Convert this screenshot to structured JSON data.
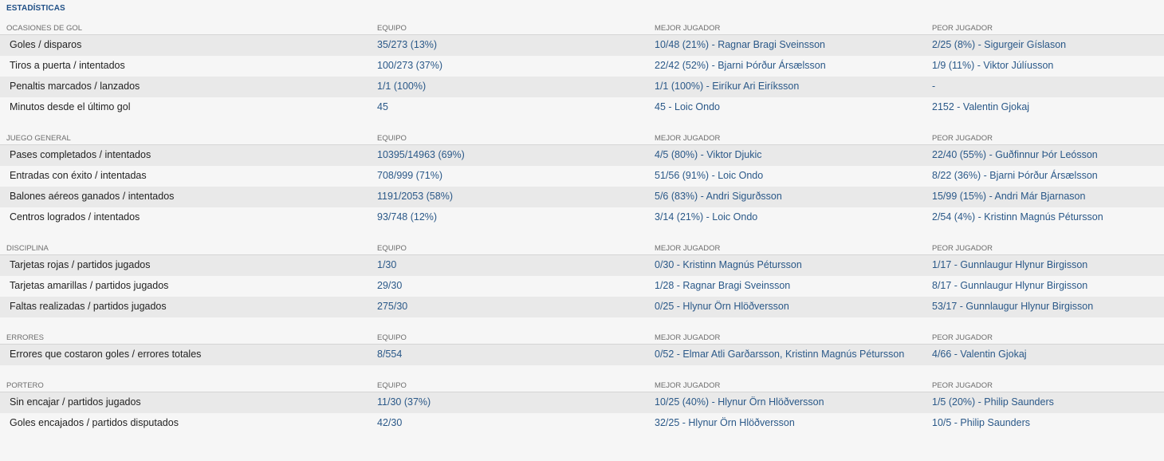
{
  "page_title": "ESTADÍSTICAS",
  "columns": {
    "team": "EQUIPO",
    "best": "MEJOR JUGADOR",
    "worst": "PEOR JUGADOR"
  },
  "sections": [
    {
      "title": "OCASIONES DE GOL",
      "rows": [
        {
          "label": "Goles / disparos",
          "team": "35/273 (13%)",
          "best": "10/48 (21%) - Ragnar Bragi Sveinsson",
          "worst": "2/25 (8%) - Sigurgeir Gíslason"
        },
        {
          "label": "Tiros a puerta / intentados",
          "team": "100/273 (37%)",
          "best": "22/42 (52%) - Bjarni Þórður Ársælsson",
          "worst": "1/9 (11%) - Viktor Júlíusson"
        },
        {
          "label": "Penaltis marcados / lanzados",
          "team": "1/1 (100%)",
          "best": "1/1 (100%) - Eiríkur Ari Eiríksson",
          "worst": "-"
        },
        {
          "label": "Minutos desde el último gol",
          "team": "45",
          "best": "45 - Loic Ondo",
          "worst": "2152 - Valentin Gjokaj"
        }
      ]
    },
    {
      "title": "JUEGO GENERAL",
      "rows": [
        {
          "label": "Pases completados / intentados",
          "team": "10395/14963 (69%)",
          "best": "4/5 (80%) - Viktor Djukic",
          "worst": "22/40 (55%) - Guðfinnur Þór Leósson"
        },
        {
          "label": "Entradas con éxito / intentadas",
          "team": "708/999 (71%)",
          "best": "51/56 (91%) - Loic Ondo",
          "worst": "8/22 (36%) - Bjarni Þórður Ársælsson"
        },
        {
          "label": "Balones aéreos ganados / intentados",
          "team": "1191/2053 (58%)",
          "best": "5/6 (83%) - Andri Sigurðsson",
          "worst": "15/99 (15%) - Andri Már Bjarnason"
        },
        {
          "label": "Centros logrados / intentados",
          "team": "93/748 (12%)",
          "best": "3/14 (21%) - Loic Ondo",
          "worst": "2/54 (4%) - Kristinn Magnús Pétursson"
        }
      ]
    },
    {
      "title": "DISCIPLINA",
      "rows": [
        {
          "label": "Tarjetas rojas / partidos jugados",
          "team": "1/30",
          "best": "0/30 - Kristinn Magnús Pétursson",
          "worst": "1/17 - Gunnlaugur Hlynur Birgisson"
        },
        {
          "label": "Tarjetas amarillas / partidos jugados",
          "team": "29/30",
          "best": "1/28 - Ragnar Bragi Sveinsson",
          "worst": "8/17 - Gunnlaugur Hlynur Birgisson"
        },
        {
          "label": "Faltas realizadas / partidos jugados",
          "team": "275/30",
          "best": "0/25 - Hlynur Örn Hlöðversson",
          "worst": "53/17 - Gunnlaugur Hlynur Birgisson"
        }
      ]
    },
    {
      "title": "ERRORES",
      "rows": [
        {
          "label": "Errores que costaron goles / errores totales",
          "team": "8/554",
          "best": "0/52 - Elmar Atli Garðarsson, Kristinn Magnús Pétursson",
          "worst": "4/66 - Valentin Gjokaj"
        }
      ]
    },
    {
      "title": "PORTERO",
      "rows": [
        {
          "label": "Sin encajar / partidos jugados",
          "team": "11/30 (37%)",
          "best": "10/25 (40%) - Hlynur Örn Hlöðversson",
          "worst": "1/5 (20%) - Philip Saunders"
        },
        {
          "label": "Goles encajados / partidos disputados",
          "team": "42/30",
          "best": "32/25 - Hlynur Örn Hlöðversson",
          "worst": "10/5 - Philip Saunders"
        }
      ]
    }
  ]
}
